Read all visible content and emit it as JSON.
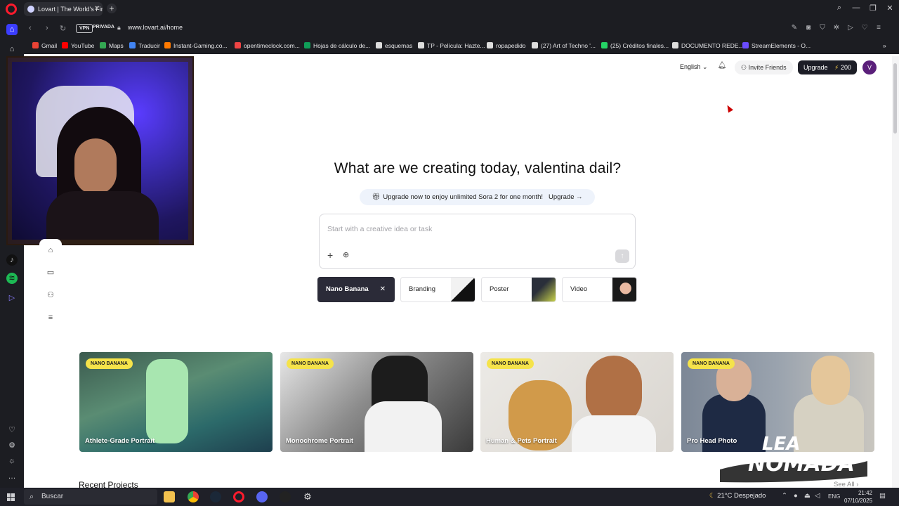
{
  "browser": {
    "tab_title": "Lovart | The World's First",
    "vpn_label": "VPN",
    "private_label": "PRIVADA",
    "url": "www.lovart.ai/home"
  },
  "bookmarks": [
    {
      "label": "Gmail",
      "color": "#ea4335"
    },
    {
      "label": "YouTube",
      "color": "#ff0000"
    },
    {
      "label": "Maps",
      "color": "#34a853"
    },
    {
      "label": "Traducir",
      "color": "#4285f4"
    },
    {
      "label": "Instant-Gaming.co...",
      "color": "#ff7a00"
    },
    {
      "label": "opentimeclock.com...",
      "color": "#e44"
    },
    {
      "label": "Hojas de cálculo de...",
      "color": "#0f9d58"
    },
    {
      "label": "esquemas",
      "color": "#ddd"
    },
    {
      "label": "TP - Película: Hazte...",
      "color": "#ddd"
    },
    {
      "label": "ropapedido",
      "color": "#ddd"
    },
    {
      "label": "(27) Art of Techno '...",
      "color": "#ddd"
    },
    {
      "label": "(25) Créditos finales...",
      "color": "#25d366"
    },
    {
      "label": "DOCUMENTO REDE...",
      "color": "#ddd"
    },
    {
      "label": "StreamElements - O...",
      "color": "#6b4cff"
    }
  ],
  "header": {
    "language": "English",
    "invite_label": "Invite Friends",
    "upgrade_label": "Upgrade",
    "credits": "200",
    "avatar_letter": "V"
  },
  "hero": {
    "title": "What are we creating today,  valentina dail?",
    "promo_text": "Upgrade now to enjoy unlimited Sora 2 for one month!",
    "promo_cta": "Upgrade",
    "prompt_placeholder": "Start with a creative idea or task"
  },
  "chips": [
    {
      "label": "Nano Banana",
      "active": true
    },
    {
      "label": "Branding",
      "active": false
    },
    {
      "label": "Poster",
      "active": false
    },
    {
      "label": "Video",
      "active": false
    }
  ],
  "cards": [
    {
      "badge": "NANO BANANA",
      "label": "Athlete-Grade Portrait"
    },
    {
      "badge": "NANO BANANA",
      "label": "Monochrome Portrait"
    },
    {
      "badge": "NANO BANANA",
      "label": "Human & Pets Portrait"
    },
    {
      "badge": "NANO BANANA",
      "label": "Pro Head Photo"
    }
  ],
  "section": {
    "recent_title": "Recent Projects",
    "see_all": "See All"
  },
  "watermark": "LEA NOMADA",
  "taskbar": {
    "search_placeholder": "Buscar",
    "weather": "21°C  Despejado",
    "lang": "ENG",
    "time": "21:42",
    "date": "07/10/2025"
  },
  "colors": {
    "accent_dark": "#1c1d26",
    "badge_yellow": "#f5e34a",
    "promo_bg": "#eef3fb"
  }
}
